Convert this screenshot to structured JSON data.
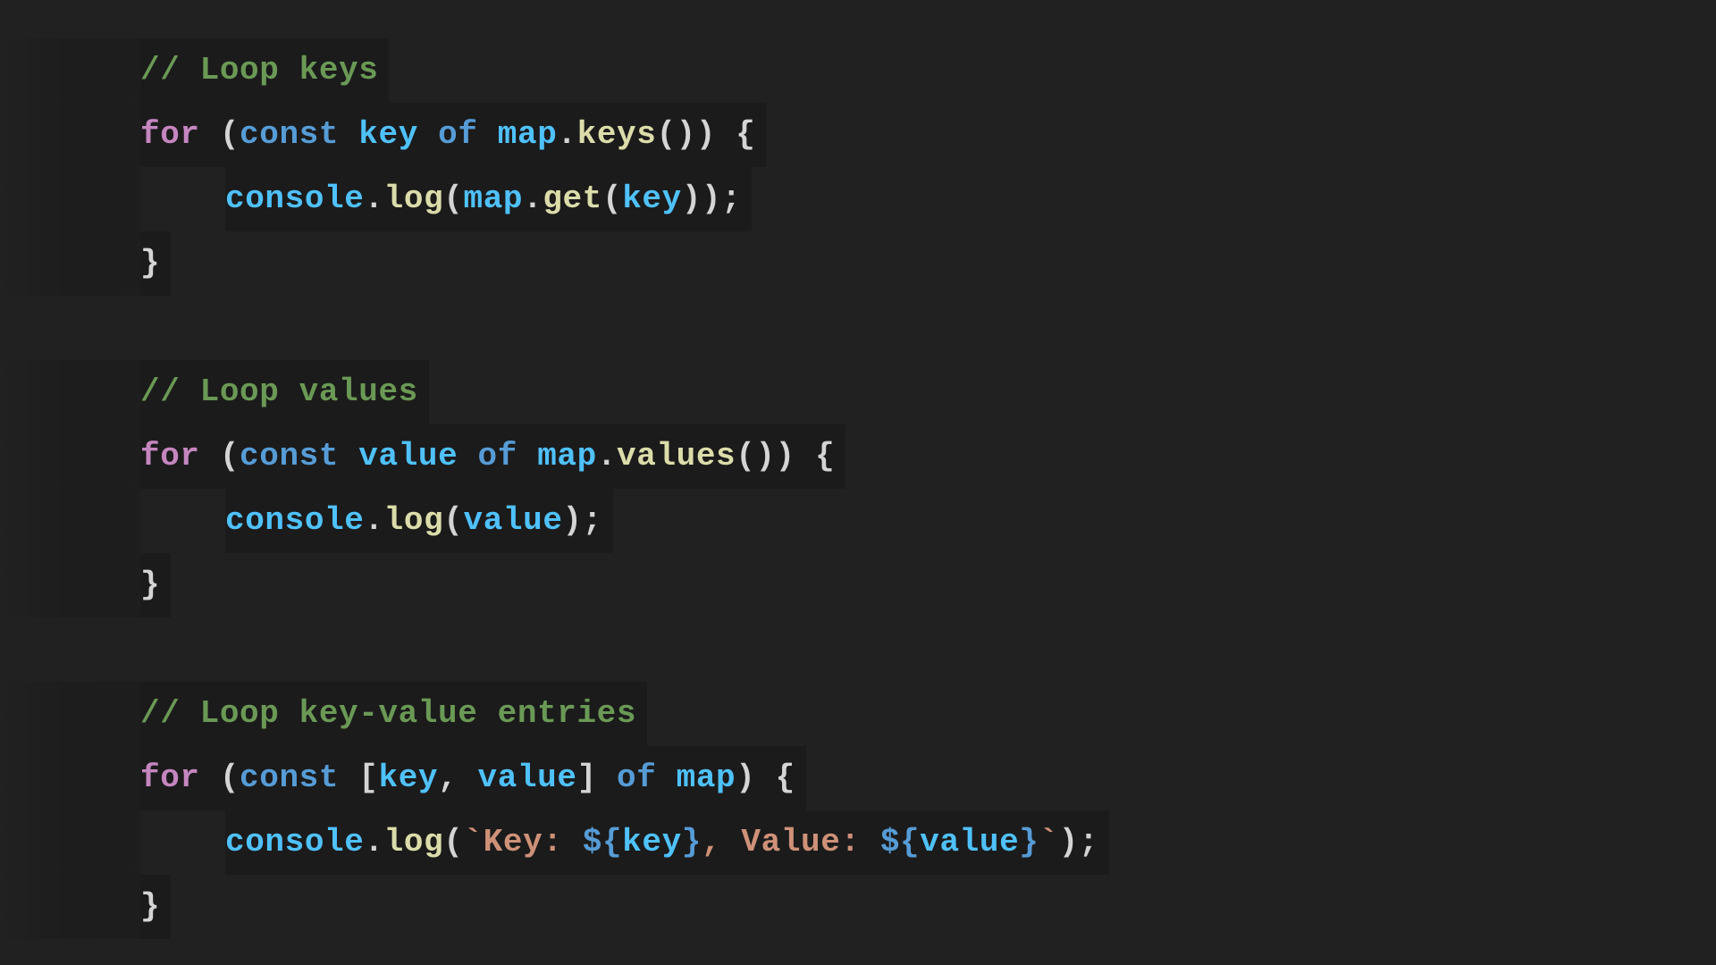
{
  "theme": {
    "background": "#212121",
    "line_highlight": "#1b1b1b",
    "colors": {
      "comment": "#6a9955",
      "keyword": "#c586c0",
      "storage": "#569cd6",
      "variable": "#4fc1ff",
      "function": "#dcdcaa",
      "punctuation": "#d4d4d4",
      "string": "#ce9178"
    }
  },
  "code": {
    "lines": [
      {
        "indent": 0,
        "tokens": [
          {
            "t": "// Loop keys",
            "c": "comment"
          }
        ]
      },
      {
        "indent": 0,
        "tokens": [
          {
            "t": "for",
            "c": "keyword"
          },
          {
            "t": " (",
            "c": "punctuation"
          },
          {
            "t": "const",
            "c": "storage"
          },
          {
            "t": " ",
            "c": "punctuation"
          },
          {
            "t": "key",
            "c": "variable"
          },
          {
            "t": " ",
            "c": "punctuation"
          },
          {
            "t": "of",
            "c": "storage"
          },
          {
            "t": " ",
            "c": "punctuation"
          },
          {
            "t": "map",
            "c": "variable"
          },
          {
            "t": ".",
            "c": "punctuation"
          },
          {
            "t": "keys",
            "c": "function"
          },
          {
            "t": "()) {",
            "c": "punctuation"
          }
        ]
      },
      {
        "indent": 1,
        "tokens": [
          {
            "t": "console",
            "c": "variable"
          },
          {
            "t": ".",
            "c": "punctuation"
          },
          {
            "t": "log",
            "c": "function"
          },
          {
            "t": "(",
            "c": "punctuation"
          },
          {
            "t": "map",
            "c": "variable"
          },
          {
            "t": ".",
            "c": "punctuation"
          },
          {
            "t": "get",
            "c": "function"
          },
          {
            "t": "(",
            "c": "punctuation"
          },
          {
            "t": "key",
            "c": "variable"
          },
          {
            "t": "));",
            "c": "punctuation"
          }
        ]
      },
      {
        "indent": 0,
        "tokens": [
          {
            "t": "}",
            "c": "punctuation"
          }
        ]
      },
      {
        "indent": 0,
        "tokens": []
      },
      {
        "indent": 0,
        "tokens": [
          {
            "t": "// Loop values",
            "c": "comment"
          }
        ]
      },
      {
        "indent": 0,
        "tokens": [
          {
            "t": "for",
            "c": "keyword"
          },
          {
            "t": " (",
            "c": "punctuation"
          },
          {
            "t": "const",
            "c": "storage"
          },
          {
            "t": " ",
            "c": "punctuation"
          },
          {
            "t": "value",
            "c": "variable"
          },
          {
            "t": " ",
            "c": "punctuation"
          },
          {
            "t": "of",
            "c": "storage"
          },
          {
            "t": " ",
            "c": "punctuation"
          },
          {
            "t": "map",
            "c": "variable"
          },
          {
            "t": ".",
            "c": "punctuation"
          },
          {
            "t": "values",
            "c": "function"
          },
          {
            "t": "()) {",
            "c": "punctuation"
          }
        ]
      },
      {
        "indent": 1,
        "tokens": [
          {
            "t": "console",
            "c": "variable"
          },
          {
            "t": ".",
            "c": "punctuation"
          },
          {
            "t": "log",
            "c": "function"
          },
          {
            "t": "(",
            "c": "punctuation"
          },
          {
            "t": "value",
            "c": "variable"
          },
          {
            "t": ");",
            "c": "punctuation"
          }
        ]
      },
      {
        "indent": 0,
        "tokens": [
          {
            "t": "}",
            "c": "punctuation"
          }
        ]
      },
      {
        "indent": 0,
        "tokens": []
      },
      {
        "indent": 0,
        "tokens": [
          {
            "t": "// Loop key-value entries",
            "c": "comment"
          }
        ]
      },
      {
        "indent": 0,
        "tokens": [
          {
            "t": "for",
            "c": "keyword"
          },
          {
            "t": " (",
            "c": "punctuation"
          },
          {
            "t": "const",
            "c": "storage"
          },
          {
            "t": " [",
            "c": "punctuation"
          },
          {
            "t": "key",
            "c": "variable"
          },
          {
            "t": ", ",
            "c": "punctuation"
          },
          {
            "t": "value",
            "c": "variable"
          },
          {
            "t": "] ",
            "c": "punctuation"
          },
          {
            "t": "of",
            "c": "storage"
          },
          {
            "t": " ",
            "c": "punctuation"
          },
          {
            "t": "map",
            "c": "variable"
          },
          {
            "t": ") {",
            "c": "punctuation"
          }
        ]
      },
      {
        "indent": 1,
        "tokens": [
          {
            "t": "console",
            "c": "variable"
          },
          {
            "t": ".",
            "c": "punctuation"
          },
          {
            "t": "log",
            "c": "function"
          },
          {
            "t": "(",
            "c": "punctuation"
          },
          {
            "t": "`Key: ",
            "c": "string"
          },
          {
            "t": "${",
            "c": "storage"
          },
          {
            "t": "key",
            "c": "variable"
          },
          {
            "t": "}",
            "c": "storage"
          },
          {
            "t": ", Value: ",
            "c": "string"
          },
          {
            "t": "${",
            "c": "storage"
          },
          {
            "t": "value",
            "c": "variable"
          },
          {
            "t": "}",
            "c": "storage"
          },
          {
            "t": "`",
            "c": "string"
          },
          {
            "t": ");",
            "c": "punctuation"
          }
        ]
      },
      {
        "indent": 0,
        "tokens": [
          {
            "t": "}",
            "c": "punctuation"
          }
        ]
      }
    ]
  }
}
